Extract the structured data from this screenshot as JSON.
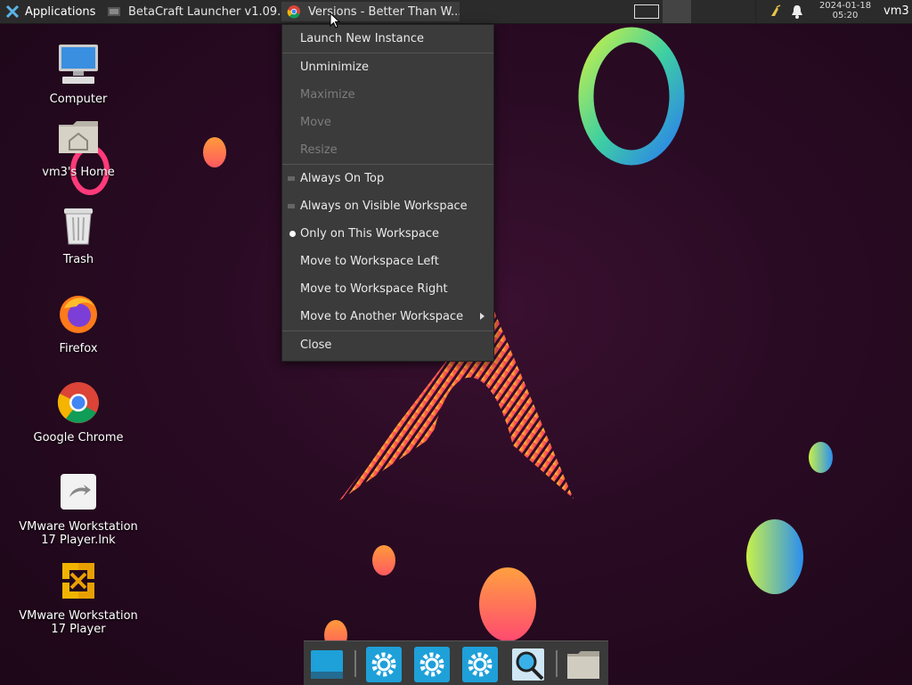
{
  "panel": {
    "applications_label": "Applications",
    "tasks": [
      {
        "title": "BetaCraft Launcher v1.09..."
      },
      {
        "title": "Versions - Better Than W..."
      }
    ],
    "clock_date": "2024-01-18",
    "clock_time": "05:20",
    "user": "vm3"
  },
  "desktop": {
    "icons": [
      {
        "label": "Computer",
        "icon": "computer-icon"
      },
      {
        "label": "vm3's Home",
        "icon": "home-folder-icon"
      },
      {
        "label": "Trash",
        "icon": "trash-icon"
      },
      {
        "label": "Firefox",
        "icon": "firefox-icon"
      },
      {
        "label": "Google Chrome",
        "icon": "chrome-icon"
      },
      {
        "label": "VMware Workstation 17 Player.lnk",
        "icon": "vmware-link-icon"
      },
      {
        "label": "VMware Workstation 17 Player",
        "icon": "vmware-icon"
      }
    ]
  },
  "menu": {
    "items": [
      {
        "label": "Launch New Instance"
      },
      {
        "label": "Unminimize"
      },
      {
        "label": "Maximize",
        "disabled": true
      },
      {
        "label": "Move",
        "disabled": true
      },
      {
        "label": "Resize",
        "disabled": true
      },
      {
        "label": "Always On Top"
      },
      {
        "label": "Always on Visible Workspace"
      },
      {
        "label": "Only on This Workspace",
        "selected": true
      },
      {
        "label": "Move to Workspace Left"
      },
      {
        "label": "Move to Workspace Right"
      },
      {
        "label": "Move to Another Workspace",
        "submenu": true
      },
      {
        "label": "Close"
      }
    ]
  },
  "dock": {
    "items": [
      "desktop-icon",
      "settings-icon",
      "settings-icon",
      "settings-icon",
      "search-icon",
      "folder-icon"
    ]
  },
  "colors": {
    "panel_bg": "#2b2b2b",
    "menu_bg": "#3b3b3b",
    "accent_blue": "#1ea0d8"
  }
}
